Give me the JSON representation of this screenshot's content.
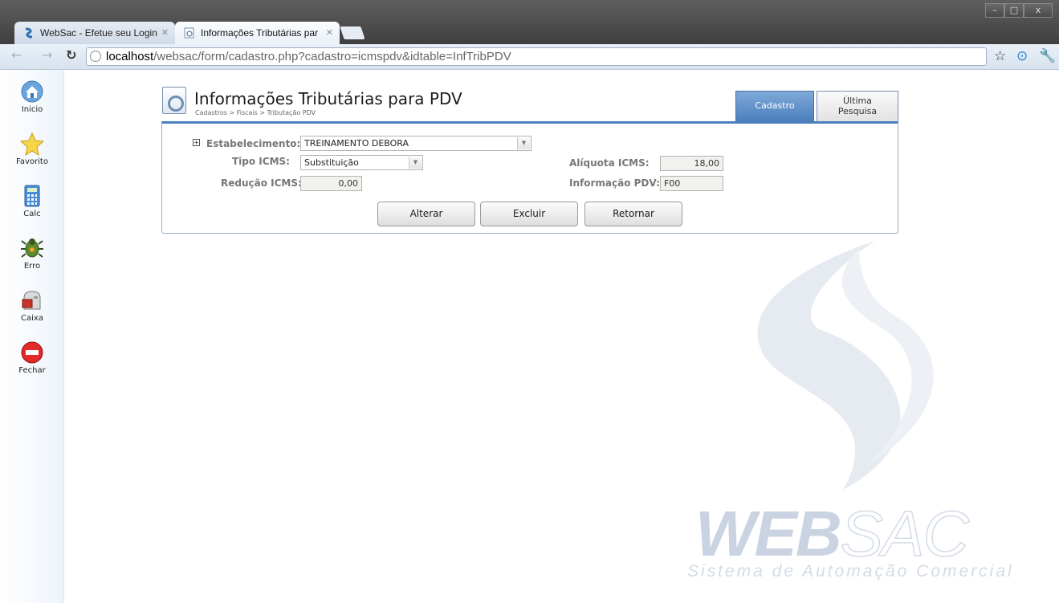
{
  "browser": {
    "tabs": [
      {
        "label": "WebSac - Efetue seu Login",
        "active": false,
        "favicon": "websac-logo-icon"
      },
      {
        "label": "Informações Tributárias par",
        "active": true,
        "favicon": "page-gear-icon"
      }
    ],
    "url_host": "localhost",
    "url_path": "/websac/form/cadastro.php?cadastro=icmspdv&idtable=InfTribPDV",
    "window_controls": {
      "minimize": "–",
      "maximize": "□",
      "close": "x"
    }
  },
  "sidebar": {
    "items": [
      {
        "label": "Inicio",
        "icon": "home-icon"
      },
      {
        "label": "Favorito",
        "icon": "star-icon"
      },
      {
        "label": "Calc",
        "icon": "calculator-icon"
      },
      {
        "label": "Erro",
        "icon": "bug-icon"
      },
      {
        "label": "Caixa",
        "icon": "mailbox-icon"
      },
      {
        "label": "Fechar",
        "icon": "stop-icon"
      }
    ]
  },
  "header": {
    "title": "Informações Tributárias para PDV",
    "breadcrumb": "Cadastros > Fiscais > Tributação PDV"
  },
  "tabs": {
    "cadastro": "Cadastro",
    "ultima_line1": "Última",
    "ultima_line2": "Pesquisa"
  },
  "form": {
    "estabelecimento": {
      "label": "Estabelecimento:",
      "value": "TREINAMENTO DEBORA"
    },
    "tipo_icms": {
      "label": "Tipo ICMS:",
      "value": "Substituição"
    },
    "aliquota_icms": {
      "label": "Alíquota ICMS:",
      "value": "18,00"
    },
    "reducao_icms": {
      "label": "Redução ICMS:",
      "value": "0,00"
    },
    "informacao_pdv": {
      "label": "Informação PDV:",
      "value": "F00"
    },
    "expander": "+"
  },
  "buttons": {
    "alterar": "Alterar",
    "excluir": "Excluir",
    "retornar": "Retornar"
  },
  "watermark": {
    "brand_a": "WEB",
    "brand_b": "SAC",
    "subtitle": "Sistema de Automação Comercial"
  },
  "colors": {
    "accent": "#4b7fbd",
    "watermark": "#c9d3e1"
  }
}
